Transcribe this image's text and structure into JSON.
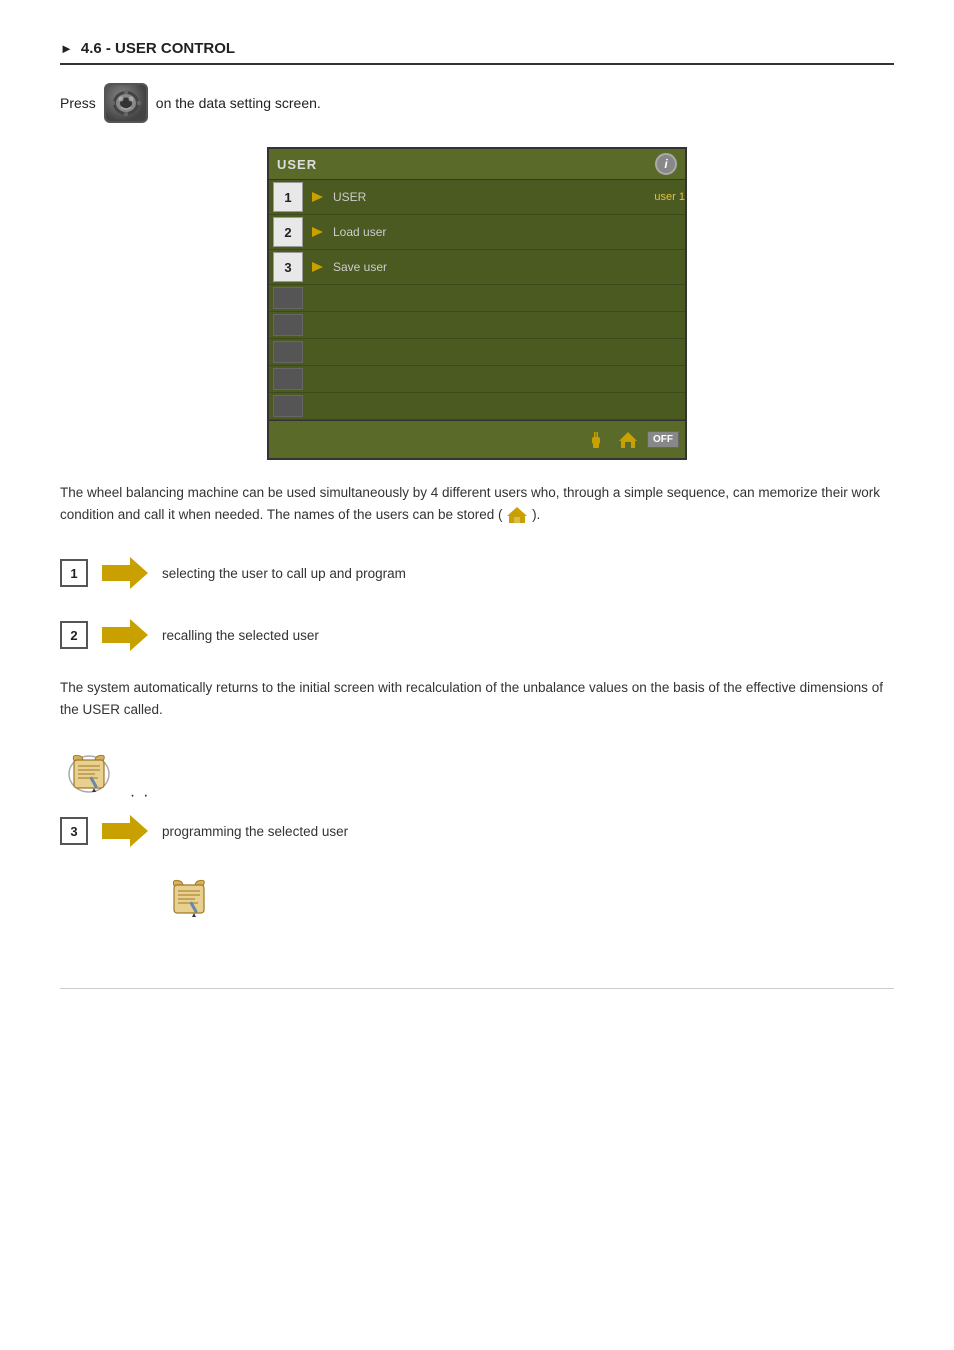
{
  "heading": {
    "bullet": "►",
    "title": "4.6 - USER CONTROL"
  },
  "press_line": {
    "prefix": "Press",
    "suffix": "on the data setting screen."
  },
  "screen": {
    "title": "USER",
    "info_label": "i",
    "rows": [
      {
        "num": "1",
        "label": "USER",
        "highlight": "user 1"
      },
      {
        "num": "2",
        "label": "Load user",
        "highlight": ""
      },
      {
        "num": "3",
        "label": "Save user",
        "highlight": ""
      }
    ],
    "empty_rows": 5,
    "bottom_icons": [
      "plug-icon",
      "house-icon",
      "off-label"
    ],
    "off_text": "OFF"
  },
  "description": "The wheel balancing machine can be used simultaneously by 4 different users who, through a simple sequence, can memorize their work condition and call it when needed. The names of the users can be stored (",
  "description_end": ").",
  "items": [
    {
      "num": "1",
      "text": "selecting the user to call up and program"
    },
    {
      "num": "2",
      "text": "recalling the selected user"
    }
  ],
  "middle_description": "The system automatically returns to the initial screen with recalculation of the unbalance values on the basis of the effective dimensions of the USER called.",
  "item3": {
    "num": "3",
    "text": "programming the selected user"
  }
}
